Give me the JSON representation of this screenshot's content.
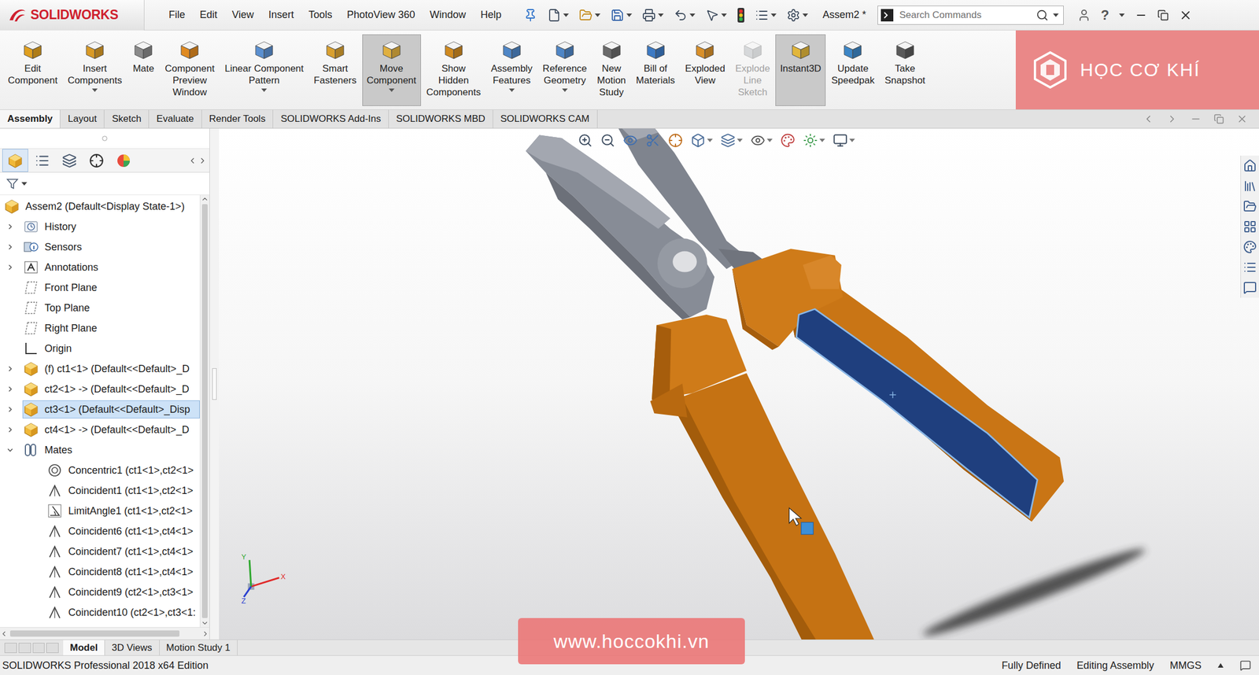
{
  "app": {
    "logo": "SOLIDWORKS",
    "document": "Assem2 *",
    "help": "?"
  },
  "menu": [
    "File",
    "Edit",
    "View",
    "Insert",
    "Tools",
    "PhotoView 360",
    "Window",
    "Help"
  ],
  "search": {
    "placeholder": "Search Commands"
  },
  "ribbon": [
    {
      "label": [
        "Edit",
        "Component"
      ],
      "pressed": false,
      "disabled": false,
      "dropdown": false
    },
    {
      "label": [
        "Insert",
        "Components"
      ],
      "pressed": false,
      "disabled": false,
      "dropdown": true
    },
    {
      "label": [
        "Mate"
      ],
      "pressed": false,
      "disabled": false,
      "dropdown": false
    },
    {
      "label": [
        "Component",
        "Preview",
        "Window"
      ],
      "pressed": false,
      "disabled": false,
      "dropdown": false
    },
    {
      "label": [
        "Linear Component",
        "Pattern"
      ],
      "pressed": false,
      "disabled": false,
      "dropdown": true
    },
    {
      "label": [
        "Smart",
        "Fasteners"
      ],
      "pressed": false,
      "disabled": false,
      "dropdown": false
    },
    {
      "label": [
        "Move",
        "Component"
      ],
      "pressed": true,
      "disabled": false,
      "dropdown": true
    },
    {
      "label": [
        "Show",
        "Hidden",
        "Components"
      ],
      "pressed": false,
      "disabled": false,
      "dropdown": false
    },
    {
      "label": [
        "Assembly",
        "Features"
      ],
      "pressed": false,
      "disabled": false,
      "dropdown": true
    },
    {
      "label": [
        "Reference",
        "Geometry"
      ],
      "pressed": false,
      "disabled": false,
      "dropdown": true
    },
    {
      "label": [
        "New",
        "Motion",
        "Study"
      ],
      "pressed": false,
      "disabled": false,
      "dropdown": false
    },
    {
      "label": [
        "Bill of",
        "Materials"
      ],
      "pressed": false,
      "disabled": false,
      "dropdown": false
    },
    {
      "label": [
        "Exploded",
        "View"
      ],
      "pressed": false,
      "disabled": false,
      "dropdown": false
    },
    {
      "label": [
        "Explode",
        "Line",
        "Sketch"
      ],
      "pressed": false,
      "disabled": true,
      "dropdown": false
    },
    {
      "label": [
        "Instant3D"
      ],
      "pressed": true,
      "disabled": false,
      "dropdown": false
    },
    {
      "label": [
        "Update",
        "Speedpak"
      ],
      "pressed": false,
      "disabled": false,
      "dropdown": false
    },
    {
      "label": [
        "Take",
        "Snapshot"
      ],
      "pressed": false,
      "disabled": false,
      "dropdown": false
    }
  ],
  "banner": {
    "text": "HỌC CƠ KHÍ"
  },
  "tabs": [
    {
      "label": "Assembly",
      "selected": true
    },
    {
      "label": "Layout",
      "selected": false
    },
    {
      "label": "Sketch",
      "selected": false
    },
    {
      "label": "Evaluate",
      "selected": false
    },
    {
      "label": "Render Tools",
      "selected": false
    },
    {
      "label": "SOLIDWORKS Add-Ins",
      "selected": false
    },
    {
      "label": "SOLIDWORKS MBD",
      "selected": false
    },
    {
      "label": "SOLIDWORKS CAM",
      "selected": false
    }
  ],
  "tree": [
    {
      "label": "Assem2 (Default<Display State-1>)",
      "kind": "assembly",
      "root": true,
      "expandable": false,
      "expanded": false,
      "selected": false
    },
    {
      "label": "History",
      "kind": "history",
      "root": false,
      "expandable": true,
      "expanded": false,
      "selected": false
    },
    {
      "label": "Sensors",
      "kind": "sensor",
      "root": false,
      "expandable": true,
      "expanded": false,
      "selected": false
    },
    {
      "label": "Annotations",
      "kind": "annotation",
      "root": false,
      "expandable": true,
      "expanded": false,
      "selected": false
    },
    {
      "label": "Front Plane",
      "kind": "plane",
      "root": false,
      "expandable": false,
      "expanded": false,
      "selected": false
    },
    {
      "label": "Top Plane",
      "kind": "plane",
      "root": false,
      "expandable": false,
      "expanded": false,
      "selected": false
    },
    {
      "label": "Right Plane",
      "kind": "plane",
      "root": false,
      "expandable": false,
      "expanded": false,
      "selected": false
    },
    {
      "label": "Origin",
      "kind": "origin",
      "root": false,
      "expandable": false,
      "expanded": false,
      "selected": false
    },
    {
      "label": "(f) ct1<1> (Default<<Default>_D",
      "kind": "part",
      "root": false,
      "expandable": true,
      "expanded": false,
      "selected": false
    },
    {
      "label": "ct2<1> -> (Default<<Default>_D",
      "kind": "part",
      "root": false,
      "expandable": true,
      "expanded": false,
      "selected": false
    },
    {
      "label": "ct3<1> (Default<<Default>_Disp",
      "kind": "part",
      "root": false,
      "expandable": true,
      "expanded": false,
      "selected": true
    },
    {
      "label": "ct4<1> -> (Default<<Default>_D",
      "kind": "part",
      "root": false,
      "expandable": true,
      "expanded": false,
      "selected": false
    },
    {
      "label": "Mates",
      "kind": "mates",
      "root": false,
      "expandable": true,
      "expanded": true,
      "selected": false,
      "children": [
        {
          "label": "Concentric1 (ct1<1>,ct2<1>",
          "kind": "concentric",
          "selected": false
        },
        {
          "label": "Coincident1 (ct1<1>,ct2<1>",
          "kind": "coincident",
          "selected": false
        },
        {
          "label": "LimitAngle1 (ct1<1>,ct2<1>",
          "kind": "limitangle",
          "selected": false
        },
        {
          "label": "Coincident6 (ct1<1>,ct4<1>",
          "kind": "coincident",
          "selected": false
        },
        {
          "label": "Coincident7 (ct1<1>,ct4<1>",
          "kind": "coincident",
          "selected": false
        },
        {
          "label": "Coincident8 (ct1<1>,ct4<1>",
          "kind": "coincident",
          "selected": false
        },
        {
          "label": "Coincident9 (ct2<1>,ct3<1>",
          "kind": "coincident",
          "selected": false
        },
        {
          "label": "Coincident10 (ct2<1>,ct3<1:",
          "kind": "coincident",
          "selected": false
        }
      ]
    }
  ],
  "triad": [
    {
      "axis": "X",
      "color": "#e02a2a"
    },
    {
      "axis": "Y",
      "color": "#2fa82f"
    },
    {
      "axis": "Z",
      "color": "#2a3fd0"
    }
  ],
  "bottom_tabs": [
    {
      "label": "Model",
      "selected": true
    },
    {
      "label": "3D Views",
      "selected": false
    },
    {
      "label": "Motion Study 1",
      "selected": false
    }
  ],
  "status_bar": {
    "edition": "SOLIDWORKS Professional 2018 x64 Edition",
    "items": [
      "Fully Defined",
      "Editing Assembly",
      "MMGS"
    ]
  },
  "watermark": "www.hoccokhi.vn"
}
